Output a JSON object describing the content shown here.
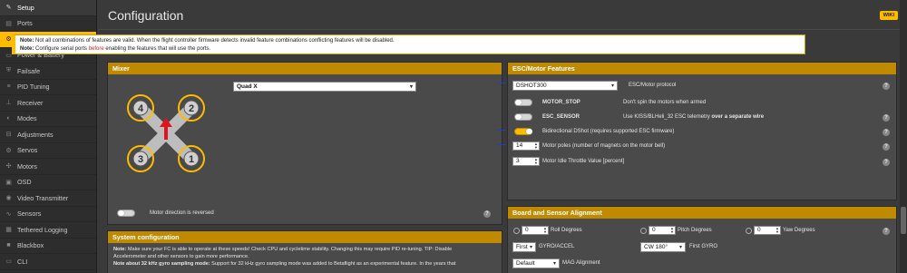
{
  "sidebar": {
    "items": [
      {
        "label": "Setup",
        "icon": "wrench-icon",
        "glyph": "✎",
        "name": "sidebar-item-setup"
      },
      {
        "label": "Ports",
        "icon": "plug-icon",
        "glyph": "▤",
        "name": "sidebar-item-ports"
      },
      {
        "label": "Configuration",
        "icon": "gear-icon",
        "glyph": "⚙",
        "name": "sidebar-item-configuration"
      },
      {
        "label": "Power & Battery",
        "icon": "battery-icon",
        "glyph": "▭",
        "name": "sidebar-item-power"
      },
      {
        "label": "Failsafe",
        "icon": "shield-icon",
        "glyph": "⛨",
        "name": "sidebar-item-failsafe"
      },
      {
        "label": "PID Tuning",
        "icon": "sliders-icon",
        "glyph": "≡",
        "name": "sidebar-item-pid"
      },
      {
        "label": "Receiver",
        "icon": "antenna-icon",
        "glyph": "⊥",
        "name": "sidebar-item-receiver"
      },
      {
        "label": "Modes",
        "icon": "modes-icon",
        "glyph": "◐",
        "name": "sidebar-item-modes"
      },
      {
        "label": "Adjustments",
        "icon": "adjust-icon",
        "glyph": "⊟",
        "name": "sidebar-item-adjustments"
      },
      {
        "label": "Servos",
        "icon": "servo-icon",
        "glyph": "⚙",
        "name": "sidebar-item-servos"
      },
      {
        "label": "Motors",
        "icon": "motor-icon",
        "glyph": "✣",
        "name": "sidebar-item-motors"
      },
      {
        "label": "OSD",
        "icon": "osd-icon",
        "glyph": "▣",
        "name": "sidebar-item-osd"
      },
      {
        "label": "Video Transmitter",
        "icon": "vtx-icon",
        "glyph": "◉",
        "name": "sidebar-item-vtx"
      },
      {
        "label": "Sensors",
        "icon": "sensor-icon",
        "glyph": "∿",
        "name": "sidebar-item-sensors"
      },
      {
        "label": "Tethered Logging",
        "icon": "log-icon",
        "glyph": "▦",
        "name": "sidebar-item-tethered"
      },
      {
        "label": "Blackbox",
        "icon": "blackbox-icon",
        "glyph": "■",
        "name": "sidebar-item-blackbox"
      },
      {
        "label": "CLI",
        "icon": "terminal-icon",
        "glyph": "▭",
        "name": "sidebar-item-cli"
      }
    ]
  },
  "header": {
    "title": "Configuration",
    "wiki": "WIKI"
  },
  "note": {
    "label1": "Note:",
    "text1": "Not all combinations of features are valid. When the flight controller firmware detects invalid feature combinations conflicting features will be disabled.",
    "label2": "Note:",
    "text2a": "Configure serial ports",
    "link": "before",
    "text2b": "enabling the features that will use the ports."
  },
  "mixer": {
    "title": "Mixer",
    "selected": "Quad X",
    "motor_labels": [
      "4",
      "2",
      "3",
      "1"
    ],
    "direction_label": "Motor direction is reversed",
    "direction_reversed": false
  },
  "system": {
    "title": "System configuration",
    "line1_label": "Note:",
    "line1": "Make sure your FC is able to operate at these speeds! Check CPU and cycletime stability. Changing this may require PID re-tuning. TIP: Disable",
    "line2": "Accelerometer and other sensors to gain more performance.",
    "line3_label": "Note about 32 kHz gyro sampling mode:",
    "line3": "Support for 32 kHz gyro sampling mode was added to Betaflight as an experimental feature. In the years that"
  },
  "esc": {
    "title": "ESC/Motor Features",
    "protocol": "DSHOT300",
    "protocol_label": "ESC/Motor protocol",
    "motor_stop_label": "MOTOR_STOP",
    "motor_stop_desc": "Don't spin the motors when armed",
    "motor_stop": false,
    "esc_sensor_label": "ESC_SENSOR",
    "esc_sensor_desc": "Use KISS/BLHeli_32 ESC telemetry",
    "esc_sensor_desc_bold": "over a separate wire",
    "esc_sensor": false,
    "bidir_label": "Bidirectional DShot (requires supported ESC firmware)",
    "bidir": true,
    "poles": "14",
    "poles_label": "Motor poles (number of magnets on the motor bell)",
    "idle": "3",
    "idle_label": "Motor Idle Throttle Value [percent]"
  },
  "board": {
    "title": "Board and Sensor Alignment",
    "roll": "0",
    "roll_label": "Roll Degrees",
    "pitch": "0",
    "pitch_label": "Pitch Degrees",
    "yaw": "0",
    "yaw_label": "Yaw Degrees",
    "gyro_first": "First",
    "gyro_first_label": "GYRO/ACCEL",
    "gyro_align": "CW 180°",
    "gyro_align_label": "First GYRO",
    "mag": "Default",
    "mag_label": "MAG Alignment"
  },
  "colors": {
    "accent": "#ffbb00",
    "panel_header": "#c08a00",
    "link": "#d42020"
  }
}
